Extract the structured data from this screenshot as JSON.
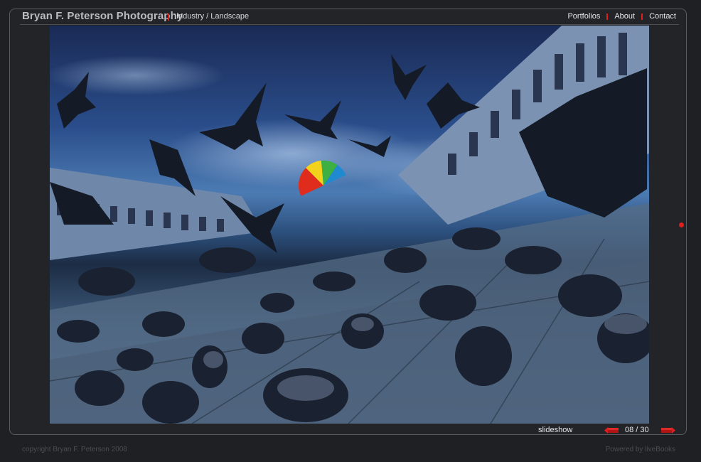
{
  "header": {
    "site_title": "Bryan F. Peterson Photography",
    "section": "Industry / Landscape"
  },
  "nav": {
    "items": [
      {
        "label": "Portfolios"
      },
      {
        "label": "About"
      },
      {
        "label": "Contact"
      }
    ]
  },
  "photo": {
    "description": "pigeons-piazza-photo"
  },
  "controls": {
    "slideshow_label": "slideshow",
    "current": "08",
    "total": "30",
    "counter_text": "08 / 30"
  },
  "footer": {
    "copyright": "copyright Bryan F. Peterson 2008",
    "powered_by": "Powered by liveBooks"
  },
  "colors": {
    "accent": "#e01e1e",
    "background": "#1e2023",
    "text": "#e6e7e8"
  }
}
